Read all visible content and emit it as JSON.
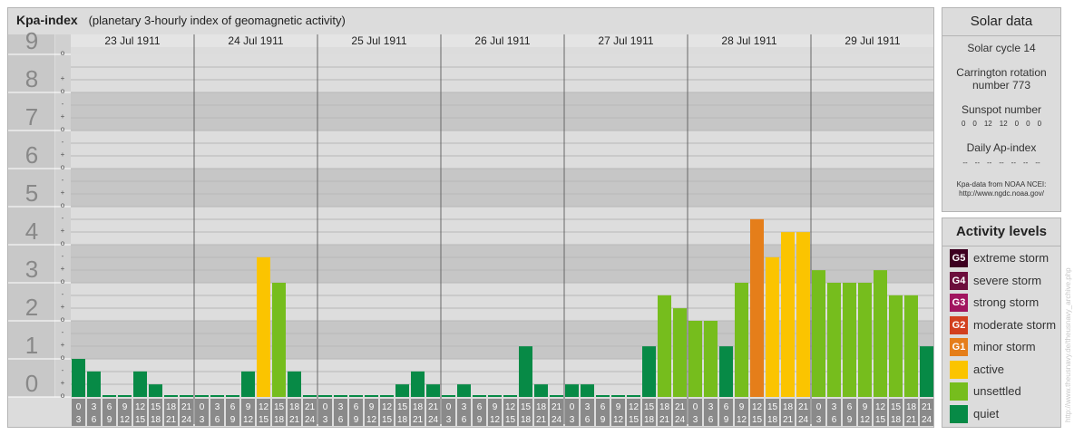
{
  "header": {
    "title": "Kpa-index",
    "subtitle": "(planetary 3-hourly index of geomagnetic activity)"
  },
  "chart_data": {
    "type": "bar",
    "title": "Kpa-index",
    "ylim": [
      0,
      9
    ],
    "y_major_labels": [
      "0",
      "1",
      "2",
      "3",
      "4",
      "5",
      "6",
      "7",
      "8",
      "9"
    ],
    "y_minor_labels": [
      "o",
      "-",
      "+"
    ],
    "days": [
      "23 Jul 1911",
      "24 Jul 1911",
      "25 Jul 1911",
      "26 Jul 1911",
      "27 Jul 1911",
      "28 Jul 1911",
      "29 Jul 1911"
    ],
    "interval_start_labels": [
      "0",
      "3",
      "6",
      "9",
      "12",
      "15",
      "18",
      "21"
    ],
    "interval_end_labels": [
      "3",
      "6",
      "9",
      "12",
      "15",
      "18",
      "21",
      "24"
    ],
    "values": [
      [
        1.0,
        0.67,
        0,
        0,
        0.67,
        0.33,
        0,
        0
      ],
      [
        0,
        0,
        0,
        0.67,
        3.67,
        3.0,
        0.67,
        0
      ],
      [
        0,
        0,
        0,
        0,
        0,
        0.33,
        0.67,
        0.33
      ],
      [
        0,
        0.33,
        0,
        0,
        0,
        1.33,
        0.33,
        0
      ],
      [
        0.33,
        0.33,
        0,
        0,
        0,
        1.33,
        2.67,
        2.33
      ],
      [
        2.0,
        2.0,
        1.33,
        3.0,
        4.67,
        3.67,
        4.33,
        4.33
      ],
      [
        3.33,
        3.0,
        3.0,
        3.0,
        3.33,
        2.67,
        2.67,
        1.33
      ]
    ],
    "level_colors": {
      "quiet": "#078a46",
      "unsettled": "#76bd1d",
      "active": "#fbc400",
      "G1": "#e57e1a",
      "G2": "#d2401e",
      "G3": "#a1155f",
      "G4": "#6c0d3c",
      "G5": "#3d0020"
    }
  },
  "solar": {
    "title": "Solar data",
    "cycle": "Solar cycle 14",
    "carrington_line1": "Carrington rotation",
    "carrington_line2": "number 773",
    "sunspot_title": "Sunspot number",
    "sunspot_values": [
      "0",
      "0",
      "12",
      "12",
      "0",
      "0",
      "0"
    ],
    "ap_title": "Daily Ap-index",
    "ap_values": [
      "--",
      "--",
      "--",
      "--",
      "--",
      "--",
      "--"
    ],
    "source_line1": "Kpa-data from NOAA NCEI:",
    "source_line2": "http://www.ngdc.noaa.gov/"
  },
  "levels": {
    "title": "Activity levels",
    "items": [
      {
        "badge": "G5",
        "label": "extreme storm",
        "color": "#3d0020"
      },
      {
        "badge": "G4",
        "label": "severe storm",
        "color": "#6c0d3c"
      },
      {
        "badge": "G3",
        "label": "strong storm",
        "color": "#a1155f"
      },
      {
        "badge": "G2",
        "label": "moderate storm",
        "color": "#d2401e"
      },
      {
        "badge": "G1",
        "label": "minor storm",
        "color": "#e57e1a"
      },
      {
        "badge": "",
        "label": "active",
        "color": "#fbc400"
      },
      {
        "badge": "",
        "label": "unsettled",
        "color": "#76bd1d"
      },
      {
        "badge": "",
        "label": "quiet",
        "color": "#078a46"
      }
    ]
  },
  "credit": "http://www.theusnavy.de/theusnavy_archive.php"
}
